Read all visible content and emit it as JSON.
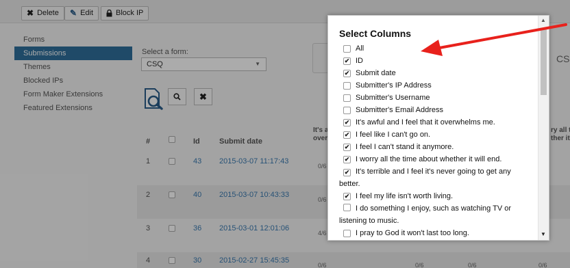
{
  "toolbar": {
    "delete_label": "Delete",
    "edit_label": "Edit",
    "block_ip_label": "Block IP"
  },
  "sidebar": {
    "items": [
      {
        "label": "Forms"
      },
      {
        "label": "Submissions",
        "active": true
      },
      {
        "label": "Themes"
      },
      {
        "label": "Blocked IPs"
      },
      {
        "label": "Form Maker Extensions"
      },
      {
        "label": "Featured Extensions"
      }
    ]
  },
  "form_select": {
    "label": "Select a form:",
    "value": "CSQ"
  },
  "form_title_fragment": "CS",
  "table": {
    "headers": {
      "num": "#",
      "id": "Id",
      "date": "Submit date",
      "col1": "It's a\nover",
      "col2": "ry all t\nther it"
    },
    "rows": [
      {
        "num": "1",
        "id": "43",
        "date": "2015-03-07 11:17:43",
        "fracs": [
          "0/6"
        ]
      },
      {
        "num": "2",
        "id": "40",
        "date": "2015-03-07 10:43:33",
        "fracs": [
          "0/6"
        ]
      },
      {
        "num": "3",
        "id": "36",
        "date": "2015-03-01 12:01:06",
        "fracs": [
          "4/6"
        ]
      },
      {
        "num": "4",
        "id": "30",
        "date": "2015-02-27 15:45:35",
        "fracs": [
          "0/6",
          "0/6",
          "0/6",
          "0/6"
        ]
      }
    ]
  },
  "popup": {
    "title": "Select Columns",
    "options": [
      {
        "label": "All",
        "checked": false
      },
      {
        "label": "ID",
        "checked": true
      },
      {
        "label": "Submit date",
        "checked": true
      },
      {
        "label": "Submitter's IP Address",
        "checked": false
      },
      {
        "label": "Submitter's Username",
        "checked": false
      },
      {
        "label": "Submitter's Email Address",
        "checked": false
      },
      {
        "label": "It's awful and I feel that it overwhelms me.",
        "checked": true
      },
      {
        "label": "I feel like I can't go on.",
        "checked": true
      },
      {
        "label": "I feel I can't stand it anymore.",
        "checked": true
      },
      {
        "label": "I worry all the time about whether it will end.",
        "checked": true
      },
      {
        "label": "It's terrible and I feel it's never going to get any better.",
        "checked": true
      },
      {
        "label": "I feel my life isn't worth living.",
        "checked": true
      },
      {
        "label": "I do something I enjoy, such as watching TV or listening to music.",
        "checked": false
      },
      {
        "label": "I pray to God it won't last too long.",
        "checked": false
      }
    ]
  },
  "colors": {
    "accent": "#2f6f9b",
    "link": "#3a7ab0",
    "arrow": "#e8211c"
  },
  "icons": {
    "delete": "close-icon",
    "edit": "edit-icon",
    "block_ip": "lock-icon",
    "search": "search-icon",
    "reset": "close-icon",
    "file_search": "file-search-icon"
  }
}
